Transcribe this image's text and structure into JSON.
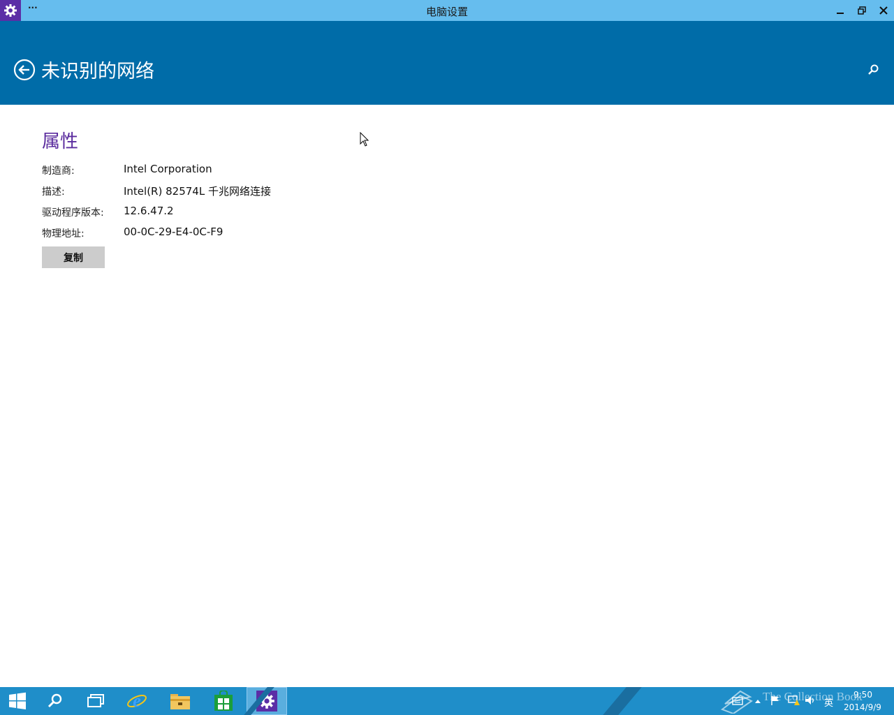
{
  "window": {
    "title": "电脑设置",
    "menu_label": "···"
  },
  "header": {
    "title": "未识别的网络"
  },
  "properties": {
    "section_title": "属性",
    "rows": [
      {
        "label": "制造商:",
        "value": "Intel Corporation"
      },
      {
        "label": "描述:",
        "value": "Intel(R) 82574L 千兆网络连接"
      },
      {
        "label": "驱动程序版本:",
        "value": "12.6.47.2"
      },
      {
        "label": "物理地址:",
        "value": "00-0C-29-E4-0C-F9"
      }
    ],
    "copy_button": "复制"
  },
  "taskbar": {
    "items": [
      "start-icon",
      "search-icon",
      "task-view-icon",
      "ie-icon",
      "file-explorer-icon",
      "store-icon",
      "settings-icon"
    ],
    "active_item": "settings-icon",
    "tray": {
      "ime": "英",
      "time": "9:50",
      "date": "2014/9/9",
      "watermark": "The Collection Book"
    }
  },
  "colors": {
    "titlebar": "#66bdee",
    "header": "#006ca8",
    "accent": "#5b2c9e",
    "taskbar": "#1f8ec9"
  }
}
